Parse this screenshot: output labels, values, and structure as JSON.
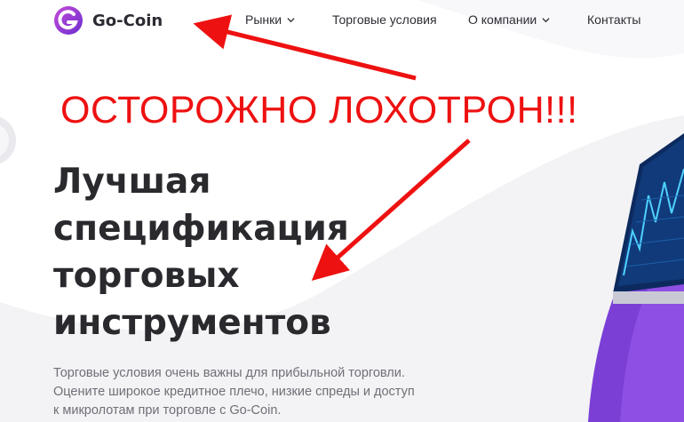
{
  "brand": {
    "name": "Go-Coin",
    "logo_icon": "go-coin-logo-icon",
    "accent": "#9b3fd6"
  },
  "nav": {
    "items": [
      {
        "label": "Рынки",
        "has_dropdown": true
      },
      {
        "label": "Торговые условия",
        "has_dropdown": false
      },
      {
        "label": "О компании",
        "has_dropdown": true
      },
      {
        "label": "Контакты",
        "has_dropdown": false
      }
    ]
  },
  "overlay": {
    "warning_text": "ОСТОРОЖНО ЛОХОТРОН!!!",
    "warning_color": "#ee1111"
  },
  "hero": {
    "title_lines": [
      "Лучшая",
      "спецификация",
      "торговых",
      "инструментов"
    ],
    "description_lines": [
      "Торговые условия очень важны для прибыльной торговли.",
      "Оцените широкое кредитное плечо, низкие спреды и доступ",
      "к микролотам при торговле с Go-Coin."
    ]
  }
}
